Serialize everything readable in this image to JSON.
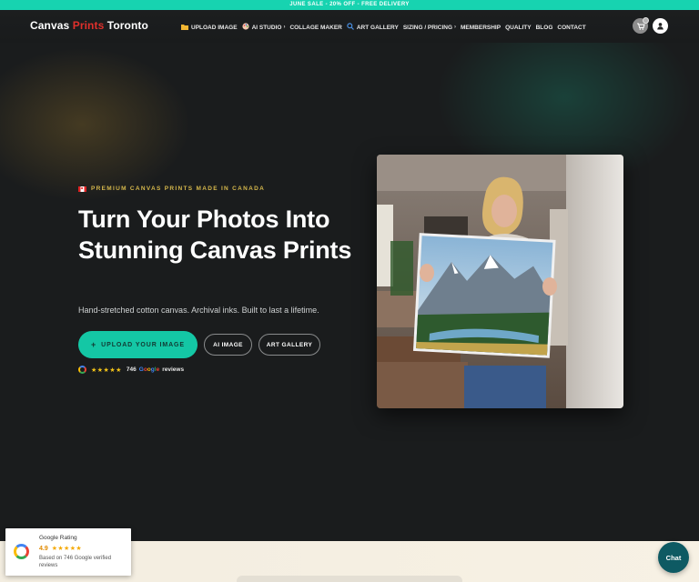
{
  "announcement": "JUNE SALE - 20% OFF - FREE DELIVERY",
  "brand": {
    "part1": "Canvas ",
    "part2": "Prints",
    "part3": " Toronto",
    "accent_color": "#e0302c"
  },
  "nav": {
    "items": [
      {
        "label": "UPLOAD IMAGE",
        "icon": "folder-icon",
        "has_dropdown": false
      },
      {
        "label": "AI STUDIO",
        "icon": "palette-icon",
        "has_dropdown": true
      },
      {
        "label": "COLLAGE MAKER",
        "icon": "",
        "has_dropdown": false
      },
      {
        "label": "ART GALLERY",
        "icon": "search-icon",
        "has_dropdown": false
      },
      {
        "label": "SIZING / PRICING",
        "icon": "",
        "has_dropdown": true
      },
      {
        "label": "MEMBERSHIP",
        "icon": "",
        "has_dropdown": false
      },
      {
        "label": "QUALITY",
        "icon": "",
        "has_dropdown": false
      },
      {
        "label": "BLOG",
        "icon": "",
        "has_dropdown": false
      },
      {
        "label": "CONTACT",
        "icon": "",
        "has_dropdown": false
      }
    ]
  },
  "hero": {
    "eyebrow": "PREMIUM CANVAS PRINTS MADE IN CANADA",
    "headline": "Turn Your Photos Into Stunning Canvas Prints",
    "subhead": "Hand-stretched cotton canvas. Archival inks. Built to last a lifetime.",
    "primary_button": "UPLOAD YOUR IMAGE",
    "secondary_buttons": [
      "AI IMAGE",
      "ART GALLERY"
    ],
    "rating": {
      "stars": "★★★★★",
      "count": "746",
      "google": "Google",
      "reviews": "reviews"
    }
  },
  "google_widget": {
    "title": "Google Rating",
    "score": "4.9",
    "stars": "★★★★★",
    "detail": "Based on 746 Google verified reviews"
  },
  "chat_label": "Chat",
  "colors": {
    "teal": "#14c7a5",
    "topbar": "#17d3b0",
    "gold": "#d6b84c"
  }
}
